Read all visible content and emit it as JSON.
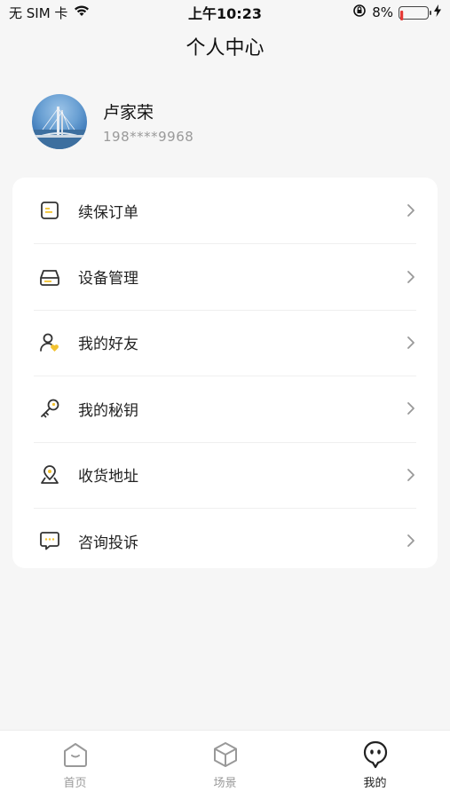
{
  "status_bar": {
    "carrier": "无 SIM 卡",
    "time": "上午10:23",
    "battery": "8%",
    "battery_color": "#e53935"
  },
  "header": {
    "title": "个人中心"
  },
  "profile": {
    "name": "卢家荣",
    "phone": "198****9968"
  },
  "menu": {
    "accent_color": "#f2c230",
    "items": [
      {
        "label": "续保订单",
        "icon": "order-icon"
      },
      {
        "label": "设备管理",
        "icon": "device-icon"
      },
      {
        "label": "我的好友",
        "icon": "friends-icon"
      },
      {
        "label": "我的秘钥",
        "icon": "key-icon"
      },
      {
        "label": "收货地址",
        "icon": "location-icon"
      },
      {
        "label": "咨询投诉",
        "icon": "message-icon"
      }
    ]
  },
  "tab_bar": {
    "tabs": [
      {
        "label": "首页",
        "icon": "home-icon",
        "active": false
      },
      {
        "label": "场景",
        "icon": "scene-cube-icon",
        "active": false
      },
      {
        "label": "我的",
        "icon": "profile-face-icon",
        "active": true
      }
    ]
  }
}
